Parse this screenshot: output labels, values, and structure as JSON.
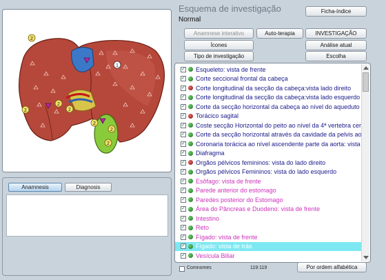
{
  "header": {
    "title": "Esquema de investigação",
    "subtitle": "Normal"
  },
  "buttons": {
    "ficha_indice": "Ficha-índice",
    "anamnese_interativo": "Anamnese interativo",
    "auto_terapia": "Auto-terapia",
    "investigacao": "INVESTIGAÇÃO",
    "icones": "Ícones",
    "analise_atual": "Análise atual",
    "tipo_investigacao": "Tipo de investigação",
    "escolha": "Escolha",
    "ordem_alfabetica": "Por ordem alfabética"
  },
  "lower_tabs": {
    "anamnesis": "Anamnesis",
    "diagnosis": "Diagnosis"
  },
  "image_markers": [
    "2",
    "2",
    "2",
    "2",
    "2",
    "2",
    "2",
    "1"
  ],
  "list_items": [
    {
      "label": "Esqueleto: vista de frente",
      "dot": "green",
      "color": "blue"
    },
    {
      "label": "Corte seccional frontal da cabeça",
      "dot": "green",
      "color": "blue"
    },
    {
      "label": "Corte longitudinal da secção da cabeça:vista lado direito",
      "dot": "red",
      "color": "blue"
    },
    {
      "label": "Corte longitudinal da secção da cabeça:vista lado esquerdo",
      "dot": "green",
      "color": "blue"
    },
    {
      "label": "Corte da secção horizontal da cabeça ao nível do  aqueduto de",
      "dot": "green",
      "color": "blue"
    },
    {
      "label": "Torácico sagital",
      "dot": "red",
      "color": "blue"
    },
    {
      "label": "Coste secção Horizontal do peito ao nível da 4ª vertebra cerv",
      "dot": "green",
      "color": "blue"
    },
    {
      "label": "Corte da secção horizontal através da cavidade da pelvis ao n",
      "dot": "green",
      "color": "blue"
    },
    {
      "label": "Coronaria torácica ao nível ascendente parte da aorta: vista d",
      "dot": "green",
      "color": "blue"
    },
    {
      "label": "Diafragma",
      "dot": "green",
      "color": "blue"
    },
    {
      "label": "Orgãos pélvicos femininos: vista do lado direito",
      "dot": "red",
      "color": "blue"
    },
    {
      "label": "Orgãos pélvicos Femininos: vista do lado esquerdo",
      "dot": "green",
      "color": "blue"
    },
    {
      "label": "Esôfago: vista de frente",
      "dot": "green",
      "color": "pink"
    },
    {
      "label": "Parede anterior do estomago",
      "dot": "green",
      "color": "pink"
    },
    {
      "label": "Paredes posterior do Estomago",
      "dot": "green",
      "color": "pink"
    },
    {
      "label": "Área do Pâncreas e Duodeno: vista de frente",
      "dot": "green",
      "color": "pink"
    },
    {
      "label": "Intestino",
      "dot": "green",
      "color": "pink"
    },
    {
      "label": "Reto",
      "dot": "green",
      "color": "pink"
    },
    {
      "label": "Fígado: vista de frente",
      "dot": "green",
      "color": "pink"
    },
    {
      "label": "Fígado: vista de trás",
      "dot": "green",
      "color": "white",
      "selected": true
    },
    {
      "label": "Vesícula Biliar",
      "dot": "green",
      "color": "pink"
    }
  ],
  "footer": {
    "comnomes": "Comnomes",
    "coords": "119:119"
  }
}
